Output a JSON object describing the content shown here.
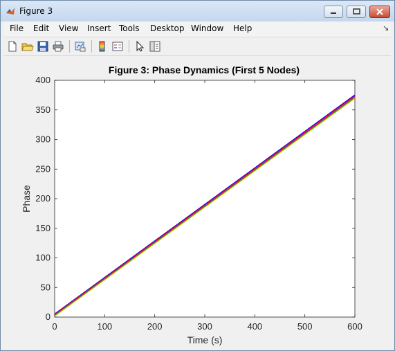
{
  "window": {
    "title": "Figure 3"
  },
  "menu": [
    "File",
    "Edit",
    "View",
    "Insert",
    "Tools",
    "Desktop",
    "Window",
    "Help"
  ],
  "toolbar": [
    "new-figure-icon",
    "open-file-icon",
    "save-icon",
    "print-icon",
    "link-plot-icon",
    "colorbar-icon",
    "legend-icon",
    "pointer-icon",
    "property-editor-icon"
  ],
  "chart_data": {
    "type": "line",
    "title": "Figure 3: Phase Dynamics (First 5 Nodes)",
    "xlabel": "Time (s)",
    "ylabel": "Phase",
    "xlim": [
      0,
      600
    ],
    "ylim": [
      0,
      400
    ],
    "xticks": [
      0,
      100,
      200,
      300,
      400,
      500,
      600
    ],
    "yticks": [
      0,
      50,
      100,
      150,
      200,
      250,
      300,
      350,
      400
    ],
    "grid": false,
    "series": [
      {
        "x": [
          0,
          600
        ],
        "y": [
          5.5,
          375.5
        ],
        "color": "#0000ff"
      },
      {
        "x": [
          0,
          600
        ],
        "y": [
          4.5,
          374.0
        ],
        "color": "#ff0000"
      },
      {
        "x": [
          0,
          600
        ],
        "y": [
          3.5,
          372.5
        ],
        "color": "#cc00cc"
      },
      {
        "x": [
          0,
          600
        ],
        "y": [
          2.5,
          371.0
        ],
        "color": "#00aa00"
      },
      {
        "x": [
          0,
          600
        ],
        "y": [
          1.5,
          369.5
        ],
        "color": "#d4c400"
      }
    ]
  }
}
